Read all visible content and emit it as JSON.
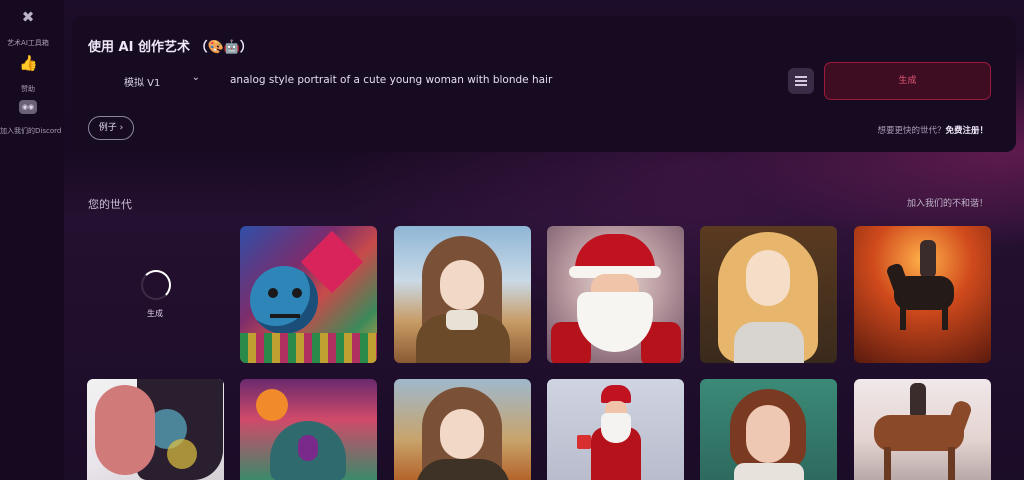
{
  "sidebar": {
    "items": [
      {
        "label": "艺术AI工具箱",
        "icon": "tools-icon"
      },
      {
        "label": "赞助",
        "icon": "thumbs-up-icon"
      },
      {
        "label": "加入我们的Discord",
        "icon": "discord-icon"
      }
    ]
  },
  "header": {
    "title": "使用 AI 创作艺术 （🎨🤖）"
  },
  "form": {
    "model_value": "模拟 V1",
    "prompt_value": "analog style portrait of a cute young woman with blonde hair",
    "generate_label": "生成",
    "examples_label": "例子 ›",
    "signup_question": "想要更快的世代？",
    "signup_link": "免费注册！"
  },
  "gallery": {
    "section_title": "您的世代",
    "discord_link": "加入我们的不和谐！",
    "loader_label": "生成"
  },
  "colors": {
    "background": "#1a0c26",
    "panel": "#170b22",
    "accent": "#9c1a3e",
    "accent_text": "#e35a7a"
  }
}
